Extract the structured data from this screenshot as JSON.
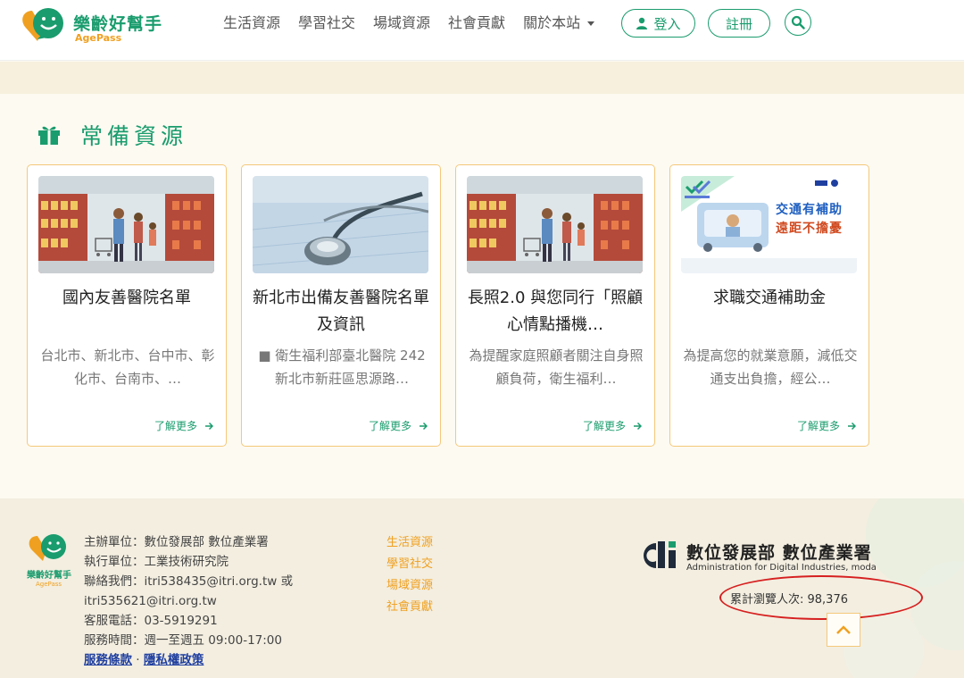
{
  "header": {
    "logo_title": "樂齡好幫手",
    "logo_sub": "AgePass",
    "nav": [
      "生活資源",
      "學習社交",
      "場域資源",
      "社會貢獻",
      "關於本站"
    ],
    "login_label": "登入",
    "register_label": "註冊"
  },
  "section": {
    "title": "常備資源",
    "cards": [
      {
        "title": "國內友善醫院名單",
        "desc": "台北市、新北市、台中市、彰化市、台南市、…",
        "more": "了解更多",
        "image": "supermarket-family"
      },
      {
        "title": "新北市出備友善醫院名單及資訊",
        "desc": "■ 衛生福利部臺北醫院 242新北市新莊區思源路…",
        "more": "了解更多",
        "image": "stethoscope"
      },
      {
        "title": "長照2.0 與您同行「照顧心情點播機…",
        "desc": "為提醒家庭照顧者關注自身照顧負荷，衛生福利…",
        "more": "了解更多",
        "image": "supermarket-family"
      },
      {
        "title": "求職交通補助金",
        "desc": "為提高您的就業意願，減低交通支出負擔，經公…",
        "more": "了解更多",
        "image": "transport-subsidy",
        "banner_line1": "交通有補助",
        "banner_line2": "遠距不擔憂"
      }
    ]
  },
  "footer": {
    "logo_title": "樂齡好幫手",
    "logo_sub": "AgePass",
    "organizer": "主辦單位：數位發展部 數位產業署",
    "executor": "執行單位：工業技術研究院",
    "contact_1": "聯絡我們：itri538435@itri.org.tw 或",
    "contact_2": "itri535621@itri.org.tw",
    "phone": "客服電話：03-5919291",
    "hours": "服務時間：週一至週五 09:00-17:00",
    "terms": "服務條款",
    "sep": "·",
    "privacy": "隱私權政策",
    "links": [
      "生活資源",
      "學習社交",
      "場域資源",
      "社會貢獻"
    ],
    "org_name": "數位發展部 數位產業署",
    "org_en": "Administration for Digital Industries, moda",
    "visit_count": "累計瀏覽人次: 98,376"
  },
  "colors": {
    "brand_green": "#1a9c6e",
    "accent_orange": "#f0a020",
    "card_border": "#f5c87a",
    "highlight_red": "#d62020"
  }
}
